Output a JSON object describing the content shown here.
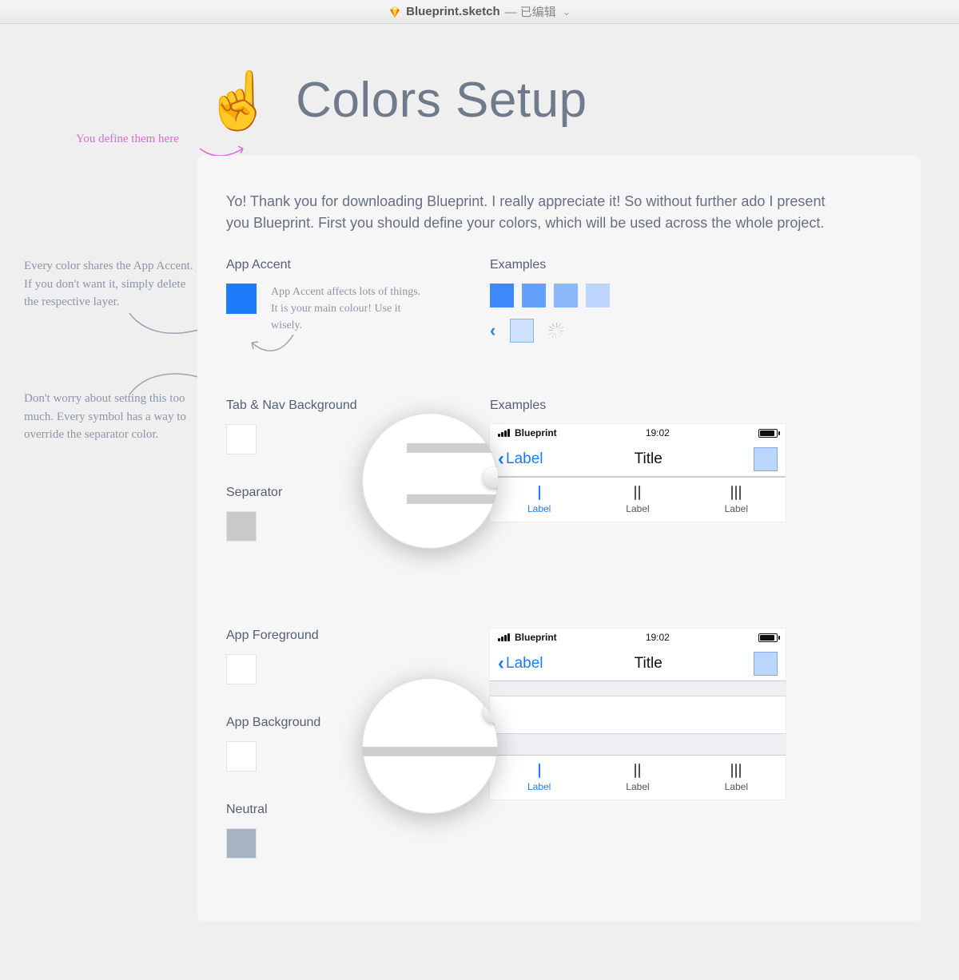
{
  "titlebar": {
    "filename": "Blueprint.sketch",
    "edited": "— 已编辑"
  },
  "heading": {
    "emoji": "☝️",
    "title": "Colors Setup"
  },
  "intro": "Yo! Thank you for downloading Blueprint. I really appreciate it! So without further ado I present you Blueprint. First you should define your colors, which will be used across the whole project.",
  "labels": {
    "app_accent": "App Accent",
    "examples": "Examples",
    "tab_nav_bg": "Tab & Nav Background",
    "separator": "Separator",
    "app_foreground": "App Foreground",
    "app_background": "App Background",
    "neutral": "Neutral"
  },
  "accent_note": "App Accent affects lots of things. It is your main colour! Use it wisely.",
  "annotations": {
    "define_here": "You define them here",
    "shares_accent": "Every color shares the App Accent. If you don't want it, simply delete the respective layer.",
    "dont_worry": "Don't worry about setting this too much. Every symbol has a way to override the separator color."
  },
  "ios": {
    "carrier": "Blueprint",
    "time": "19:02",
    "back_label": "Label",
    "title": "Title",
    "tab_label": "Label"
  },
  "colors": {
    "accent": "#1c7cf9",
    "shades": [
      "#3d89fb",
      "#639ffb",
      "#8cb8fb",
      "#bdd4fd"
    ],
    "tab_nav_bg": "#ffffff",
    "separator": "#c9c9cc",
    "app_foreground": "#ffffff",
    "app_background": "#ffffff",
    "neutral": "#a6b3c3"
  }
}
